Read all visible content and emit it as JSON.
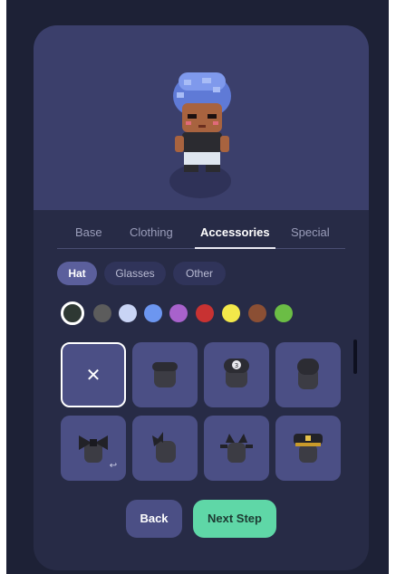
{
  "tabs": [
    {
      "label": "Base"
    },
    {
      "label": "Clothing"
    },
    {
      "label": "Accessories",
      "active": true
    },
    {
      "label": "Special"
    }
  ],
  "subtabs": [
    {
      "label": "Hat",
      "active": true
    },
    {
      "label": "Glasses"
    },
    {
      "label": "Other"
    }
  ],
  "colors": [
    "#2e3833",
    "#5c5c5c",
    "#c9d4f5",
    "#6c96f0",
    "#a862cc",
    "#c83232",
    "#f3e84a",
    "#8b4f34",
    "#6bbd45"
  ],
  "selected_color_index": 0,
  "accessory_items": [
    {
      "icon": "none-icon",
      "glyph": "✕",
      "selected": true
    },
    {
      "icon": "headband-icon"
    },
    {
      "icon": "cap-3-icon",
      "badge": "3"
    },
    {
      "icon": "beanie-icon"
    },
    {
      "icon": "bow-icon",
      "badge": "↩"
    },
    {
      "icon": "side-bow-icon"
    },
    {
      "icon": "cat-ears-icon"
    },
    {
      "icon": "captain-hat-icon"
    }
  ],
  "actions": {
    "back_label": "Back",
    "next_label": "Next Step"
  },
  "avatar": {
    "hair_color": "#6a86e0",
    "skin_color": "#a8633f",
    "shirt_color": "#2b2b30"
  }
}
